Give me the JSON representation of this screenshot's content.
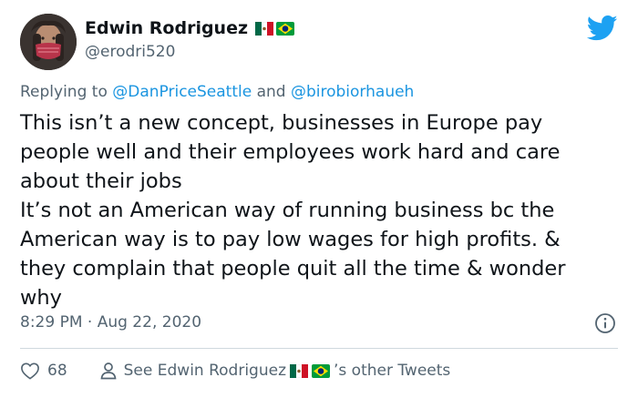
{
  "user": {
    "display_name": "Edwin Rodriguez",
    "handle": "@erodri520",
    "flags": [
      "mexico-flag",
      "brazil-flag"
    ]
  },
  "reply": {
    "prefix": "Replying to",
    "mention_1": "@DanPriceSeattle",
    "joiner": "and",
    "mention_2": "@birobiorhaueh"
  },
  "tweet": {
    "text": "This isn’t a new concept, businesses in Europe pay\npeople well and their employees work hard and care\nabout their jobs\nIt’s not an American way of running business bc the\nAmerican way is to pay low wages for high profits. &\nthey complain that people quit all the time & wonder\nwhy",
    "timestamp": "8:29 PM · Aug 22, 2020"
  },
  "actions": {
    "like_count": "68",
    "see_prefix": "See Edwin Rodriguez",
    "see_suffix": "’s other Tweets"
  },
  "colors": {
    "brand": "#1da1f2",
    "mention": "#1b95e0",
    "muted": "#536471",
    "text": "#0f1419"
  }
}
